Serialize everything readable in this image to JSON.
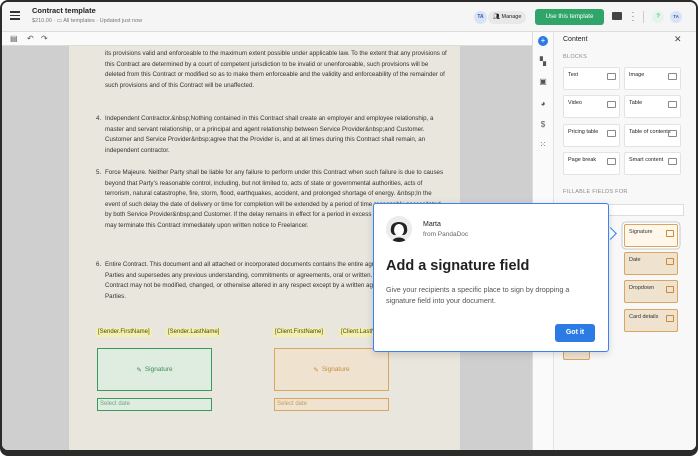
{
  "topbar": {
    "title": "Contract template",
    "price": "$210.00",
    "location": "All templates",
    "status": "Updated just now",
    "avatar": "TA",
    "manage": "Manage",
    "use_template": "Use this template",
    "help": "?",
    "user_avatar": "TA"
  },
  "document": {
    "clause_3_cont": "its provisions valid and enforceable to the maximum extent possible under applicable law. To the extent that any provisions of this Contract are determined by a court of competent jurisdiction to be invalid or unenforceable, such provisions will be deleted from this Contract or modified so as to make them enforceable and the validity and enforceability of the remainder of such provisions and of this Contract will be unaffected.",
    "clause_4_num": "4.",
    "clause_4": "Independent Contractor.&nbsp;Nothing contained in this Contract shall create an employer and employee relationship, a master and servant relationship, or a principal and agent relationship between Service Provider&nbsp;and Customer. Customer and Service Provider&nbsp;agree that the Provider is, and at all times during this Contract shall remain, an independent contractor.",
    "clause_5_num": "5.",
    "clause_5": "Force Majeure. Neither Party shall be liable for any failure to perform under this Contract when such failure is due to causes beyond that Party’s reasonable control, including, but not limited to, acts of state or governmental authorities, acts of terrorism, natural catastrophe, fire, storm, flood, earthquakes, accident, and prolonged shortage of energy. &nbsp;In the event of such delay the date of delivery or time for completion will be extended by a period of time reasonably necessitated by both Service Provider&nbsp;and Customer. If the delay remains in effect for a period in excess of thirty days, Customer may terminate this Contract immediately upon written notice to Freelancer.",
    "clause_6_num": "6.",
    "clause_6": "Entire Contract. This document and all attached or incorporated documents contains the entire agreement between the Parties and supersedes any previous understanding, commitments or agreements, oral or written. &nbsp;Further, this Contract may not be modified, changed, or otherwise altered in any respect except by a written agreement signed by both Parties.",
    "sender_first": "[Sender.FirstName]",
    "sender_last": "[Sender.LastName]",
    "client_first": "[Client.FirstName]",
    "client_last": "[Client.LastName]",
    "signature_label": "Signature",
    "select_date": "Select date"
  },
  "panel": {
    "title": "Content",
    "blocks_heading": "BLOCKS",
    "blocks": [
      "Text",
      "Image",
      "Video",
      "Table",
      "Pricing table",
      "Table of contents",
      "Page break",
      "Smart content"
    ],
    "fillable_heading": "FILLABLE FIELDS FOR",
    "assignee_placeholder": "g name or email",
    "fields": [
      "Signature",
      "Date",
      "Dropdown",
      "Card details"
    ]
  },
  "tooltip": {
    "name": "Marta",
    "from": "from PandaDoc",
    "heading": "Add a signature field",
    "body": "Give your recipients a specific place to sign by dropping a signature field into your document.",
    "button": "Got it"
  },
  "colors": {
    "primary": "#2c7be5",
    "use_template": "#2fa56a",
    "sender_field": "#3a9a5c",
    "client_field": "#d9a563"
  }
}
